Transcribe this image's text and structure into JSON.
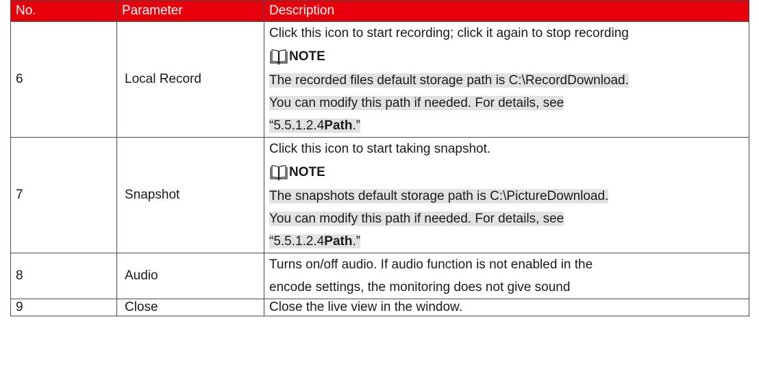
{
  "table": {
    "headers": [
      "No.",
      "Parameter",
      "Description"
    ],
    "rows": [
      {
        "no": "6",
        "parameter": "Local Record",
        "description": "Click this icon to start recording; click it again to stop recording",
        "note_label": "NOTE",
        "note_lines": [
          "The recorded files default storage path is C:\\RecordDownload.",
          "You can modify this path if needed. For details, see "
        ],
        "ref_prefix": "“5.5.1.2.4",
        "ref_bold": "Path",
        "ref_suffix": ".”"
      },
      {
        "no": "7",
        "parameter": "Snapshot",
        "description": "Click this icon to start taking snapshot.",
        "note_label": "NOTE",
        "note_lines": [
          "The snapshots default storage path is C:\\PictureDownload.",
          "You can modify this path if needed. For details, see "
        ],
        "ref_prefix": "“5.5.1.2.4",
        "ref_bold": "Path",
        "ref_suffix": ".”"
      },
      {
        "no": "8",
        "parameter": "Audio",
        "description_lines": [
          "Turns on/off audio. If audio function is not enabled in the",
          "encode settings, the monitoring does not give sound"
        ]
      },
      {
        "no": "9",
        "parameter": "Close",
        "description": "Close the live view in the window."
      }
    ]
  },
  "colors": {
    "header_bg": "#e8000b",
    "header_text": "#ffffff",
    "note_highlight": "#e2e2e2"
  },
  "icons": {
    "note": "book-icon"
  }
}
